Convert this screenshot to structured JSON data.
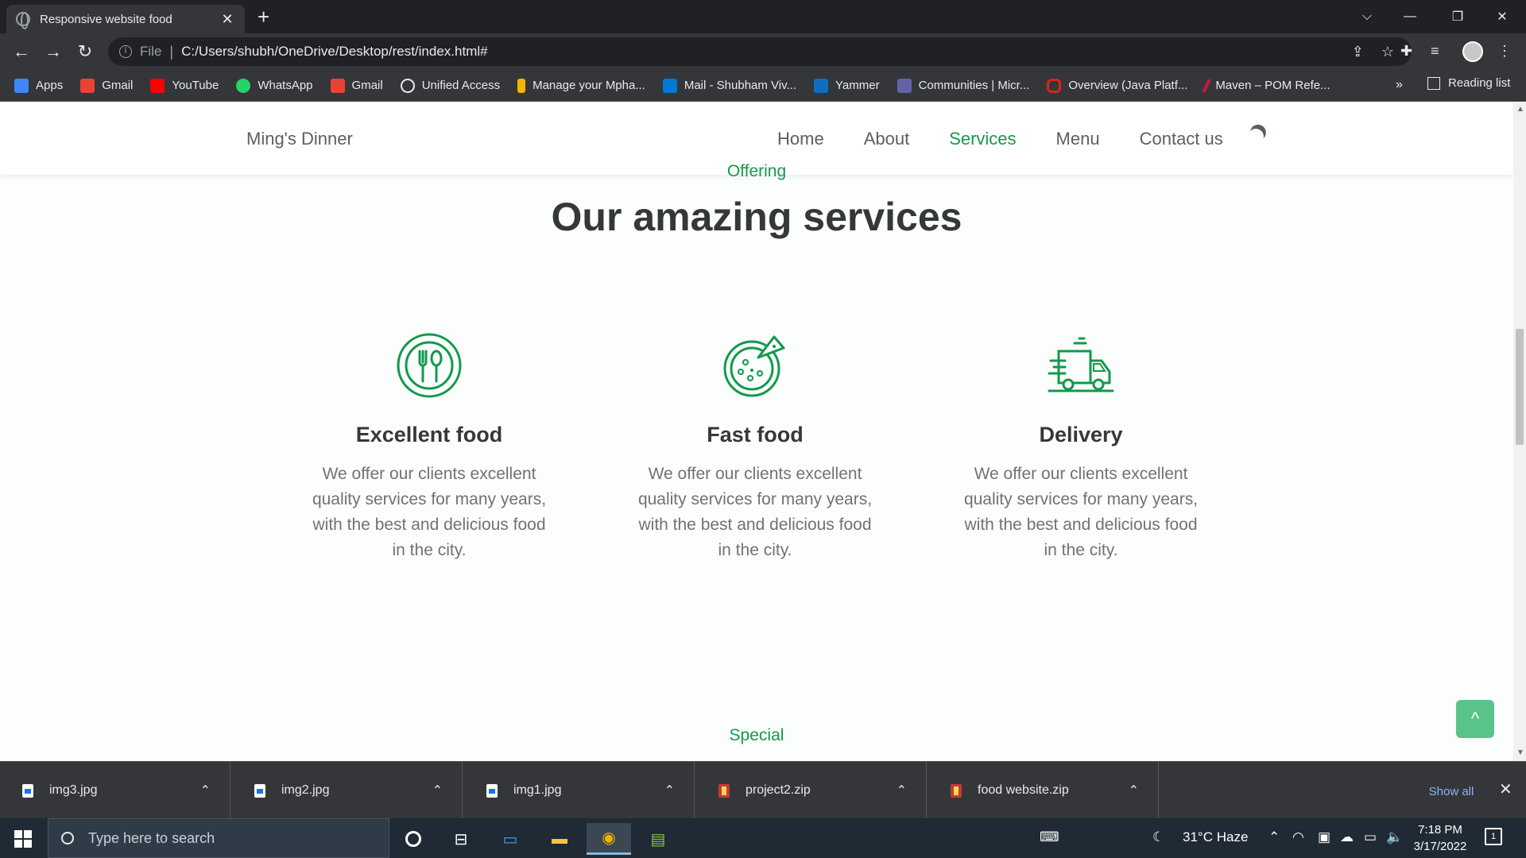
{
  "browser": {
    "tab_title": "Responsive website food",
    "tab_close": "✕",
    "new_tab": "+",
    "url_scheme": "File",
    "url": "C:/Users/shubh/OneDrive/Desktop/rest/index.html#",
    "window_controls": {
      "tablist": "⌵",
      "minimize": "—",
      "restore": "❐",
      "close": "✕"
    }
  },
  "bookmarks": {
    "items": [
      {
        "label": "Apps",
        "icon": "apps-grid-icon",
        "color": "#4285f4"
      },
      {
        "label": "Gmail",
        "icon": "gmail-icon",
        "color": "#ea4335"
      },
      {
        "label": "YouTube",
        "icon": "youtube-icon",
        "color": "#ff0000"
      },
      {
        "label": "WhatsApp",
        "icon": "whatsapp-icon",
        "color": "#25d366"
      },
      {
        "label": "Gmail",
        "icon": "gmail-icon",
        "color": "#ea4335"
      },
      {
        "label": "Unified Access",
        "icon": "globe-icon",
        "color": "#e8eaed"
      },
      {
        "label": "Manage your Mpha...",
        "icon": "chart-icon",
        "color": "#f4b400"
      },
      {
        "label": "Mail - Shubham Viv...",
        "icon": "outlook-icon",
        "color": "#0078d4"
      },
      {
        "label": "Yammer",
        "icon": "yammer-icon",
        "color": "#106ebe"
      },
      {
        "label": "Communities | Micr...",
        "icon": "teams-icon",
        "color": "#6264a7"
      },
      {
        "label": "Overview (Java Platf...",
        "icon": "oracle-icon",
        "color": "#e0201b"
      },
      {
        "label": "Maven – POM Refe...",
        "icon": "maven-icon",
        "color": "#c71a36"
      }
    ],
    "more": "»",
    "reading_list": "Reading list"
  },
  "site": {
    "logo": "Ming's Dinner",
    "nav": [
      "Home",
      "About",
      "Services",
      "Menu",
      "Contact us"
    ],
    "active_nav": "Services",
    "accent_color": "#13994a",
    "section": {
      "subtitle": "Offering",
      "title": "Our amazing services",
      "cards": [
        {
          "icon": "fork-spoon-plate-icon",
          "title": "Excellent food",
          "text": "We offer our clients excellent quality services for many years, with the best and delicious food in the city."
        },
        {
          "icon": "pizza-icon",
          "title": "Fast food",
          "text": "We offer our clients excellent quality services for many years, with the best and delicious food in the city."
        },
        {
          "icon": "delivery-truck-icon",
          "title": "Delivery",
          "text": "We offer our clients excellent quality services for many years, with the best and delicious food in the city."
        }
      ]
    },
    "next_subtitle": "Special",
    "scroll_top_icon": "^"
  },
  "downloads": {
    "items": [
      {
        "name": "img3.jpg",
        "type": "image"
      },
      {
        "name": "img2.jpg",
        "type": "image"
      },
      {
        "name": "img1.jpg",
        "type": "image"
      },
      {
        "name": "project2.zip",
        "type": "zip"
      },
      {
        "name": "food website.zip",
        "type": "zip"
      }
    ],
    "show_all": "Show all",
    "close": "✕"
  },
  "taskbar": {
    "search_placeholder": "Type here to search",
    "weather": "31°C Haze",
    "time": "7:18 PM",
    "date": "3/17/2022",
    "notifications": "1"
  }
}
